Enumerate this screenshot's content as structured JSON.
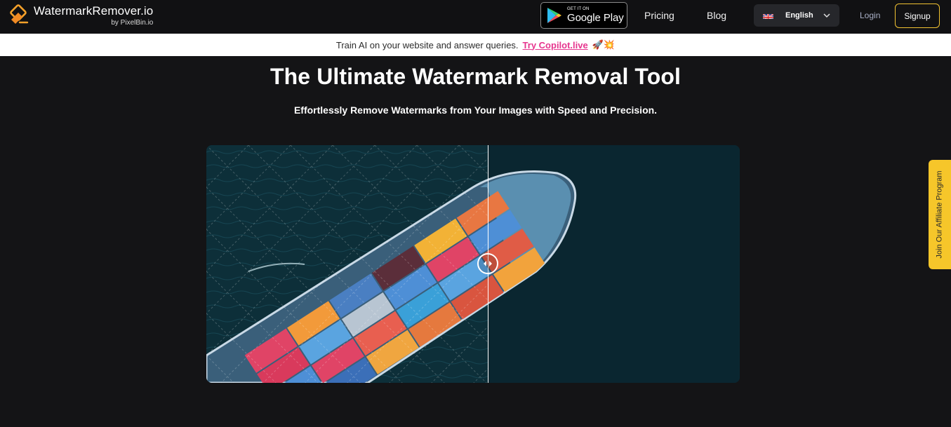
{
  "header": {
    "logo_name": "WatermarkRemover.io",
    "logo_by": "by PixelBin.io",
    "logo_icon": "watermark-remover-logo-icon",
    "google_play_small": "GET IT ON",
    "google_play_big": "Google Play",
    "nav": {
      "pricing": "Pricing",
      "blog": "Blog"
    },
    "language": "English",
    "login": "Login",
    "signup": "Signup"
  },
  "banner": {
    "text": "Train AI on your website and answer queries.",
    "link": "Try Copilot.live",
    "emoji": "🚀💥"
  },
  "hero": {
    "title": "The Ultimate Watermark Removal Tool",
    "subtitle": "Effortlessly Remove Watermarks from Your Images with Speed and Precision."
  },
  "compare": {
    "image_alt": "Aerial view of container ship at sea",
    "slider_position": 0.528
  },
  "affiliate": {
    "label": "Join Our Affiliate Program"
  },
  "colors": {
    "accent_yellow": "#f6c62a",
    "signup_border": "#f1c232",
    "copilot_link": "#e6358e",
    "background": "#141416"
  }
}
